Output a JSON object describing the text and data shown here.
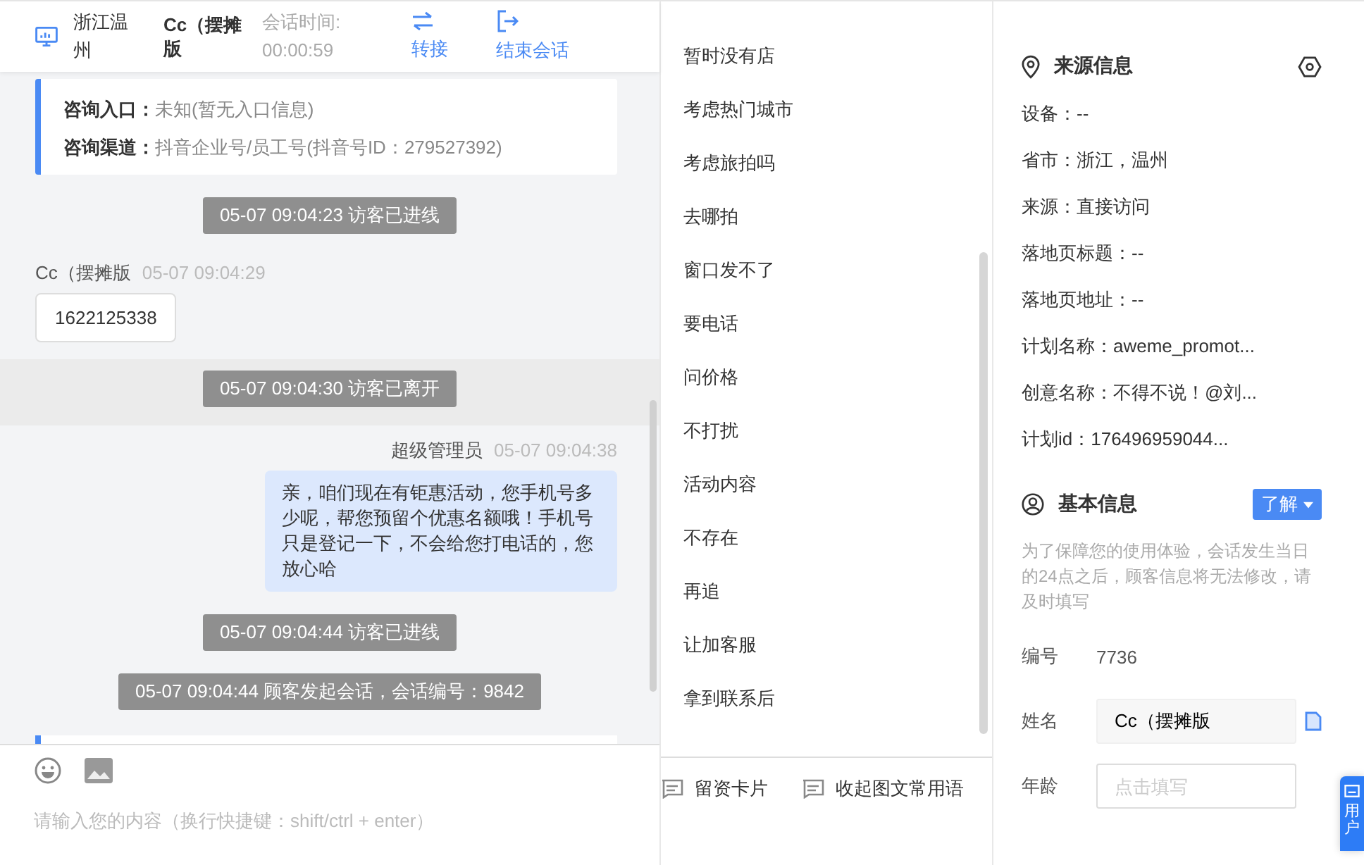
{
  "header": {
    "location": "浙江温州",
    "visitor": "Cc（摆摊版",
    "timer_label": "会话时间:",
    "timer": "00:00:59",
    "actions": [
      {
        "label": "转接",
        "kind": "transfer"
      },
      {
        "label": "结束会话",
        "kind": "end"
      }
    ]
  },
  "messages": [
    {
      "kind": "info_card",
      "entries": [
        {
          "label": "咨询入口：",
          "value": "未知(暂无入口信息)"
        },
        {
          "label": "咨询渠道：",
          "value": "抖音企业号/员工号(抖音号ID：279527392)"
        }
      ]
    },
    {
      "kind": "system",
      "text": "05-07 09:04:23 访客已进线",
      "highlighted": false
    },
    {
      "kind": "visitor",
      "name": "Cc（摆摊版",
      "time": "05-07 09:04:29",
      "text": "1622125338"
    },
    {
      "kind": "system",
      "text": "05-07 09:04:30 访客已离开",
      "highlighted": true
    },
    {
      "kind": "agent",
      "name": "超级管理员",
      "time": "05-07 09:04:38",
      "text": "亲，咱们现在有钜惠活动，您手机号多少呢，帮您预留个优惠名额哦！手机号只是登记一下，不会给您打电话的，您放心哈"
    },
    {
      "kind": "system",
      "text": "05-07 09:04:44 访客已进线",
      "highlighted": false
    },
    {
      "kind": "system",
      "text": "05-07 09:04:44 顾客发起会话，会话编号：9842",
      "highlighted": false
    }
  ],
  "composer": {
    "placeholder": "请输入您的内容（换行快捷键：shift/ctrl + enter）"
  },
  "quick_phrases": [
    "暂时没有店",
    "考虑热门城市",
    "考虑旅拍吗",
    "去哪拍",
    "窗口发不了",
    "要电话",
    "问价格",
    "不打扰",
    "活动内容",
    "不存在",
    "再追",
    "让加客服",
    "拿到联系后"
  ],
  "phrase_tools": [
    {
      "label": "留资卡片"
    },
    {
      "label": "收起图文常用语"
    }
  ],
  "source_info": {
    "title": "来源信息",
    "fields": [
      "设备：--",
      "省市：浙江，温州",
      "来源：直接访问",
      "落地页标题：--",
      "落地页地址：--",
      "计划名称：aweme_promot...",
      "创意名称：不得不说！@刘...",
      "计划id：176496959044..."
    ]
  },
  "basic_info": {
    "title": "基本信息",
    "learn_button": "了解",
    "notice": "为了保障您的使用体验，会话发生当日的24点之后，顾客信息将无法修改，请及时填写",
    "fields": [
      {
        "kind": "text",
        "label": "编号",
        "value": "7736"
      },
      {
        "kind": "filled",
        "label": "姓名",
        "value": "Cc（摆摊版"
      },
      {
        "kind": "input",
        "label": "年龄",
        "placeholder": "点击填写"
      }
    ]
  },
  "side_tab": {
    "label": "用户"
  }
}
